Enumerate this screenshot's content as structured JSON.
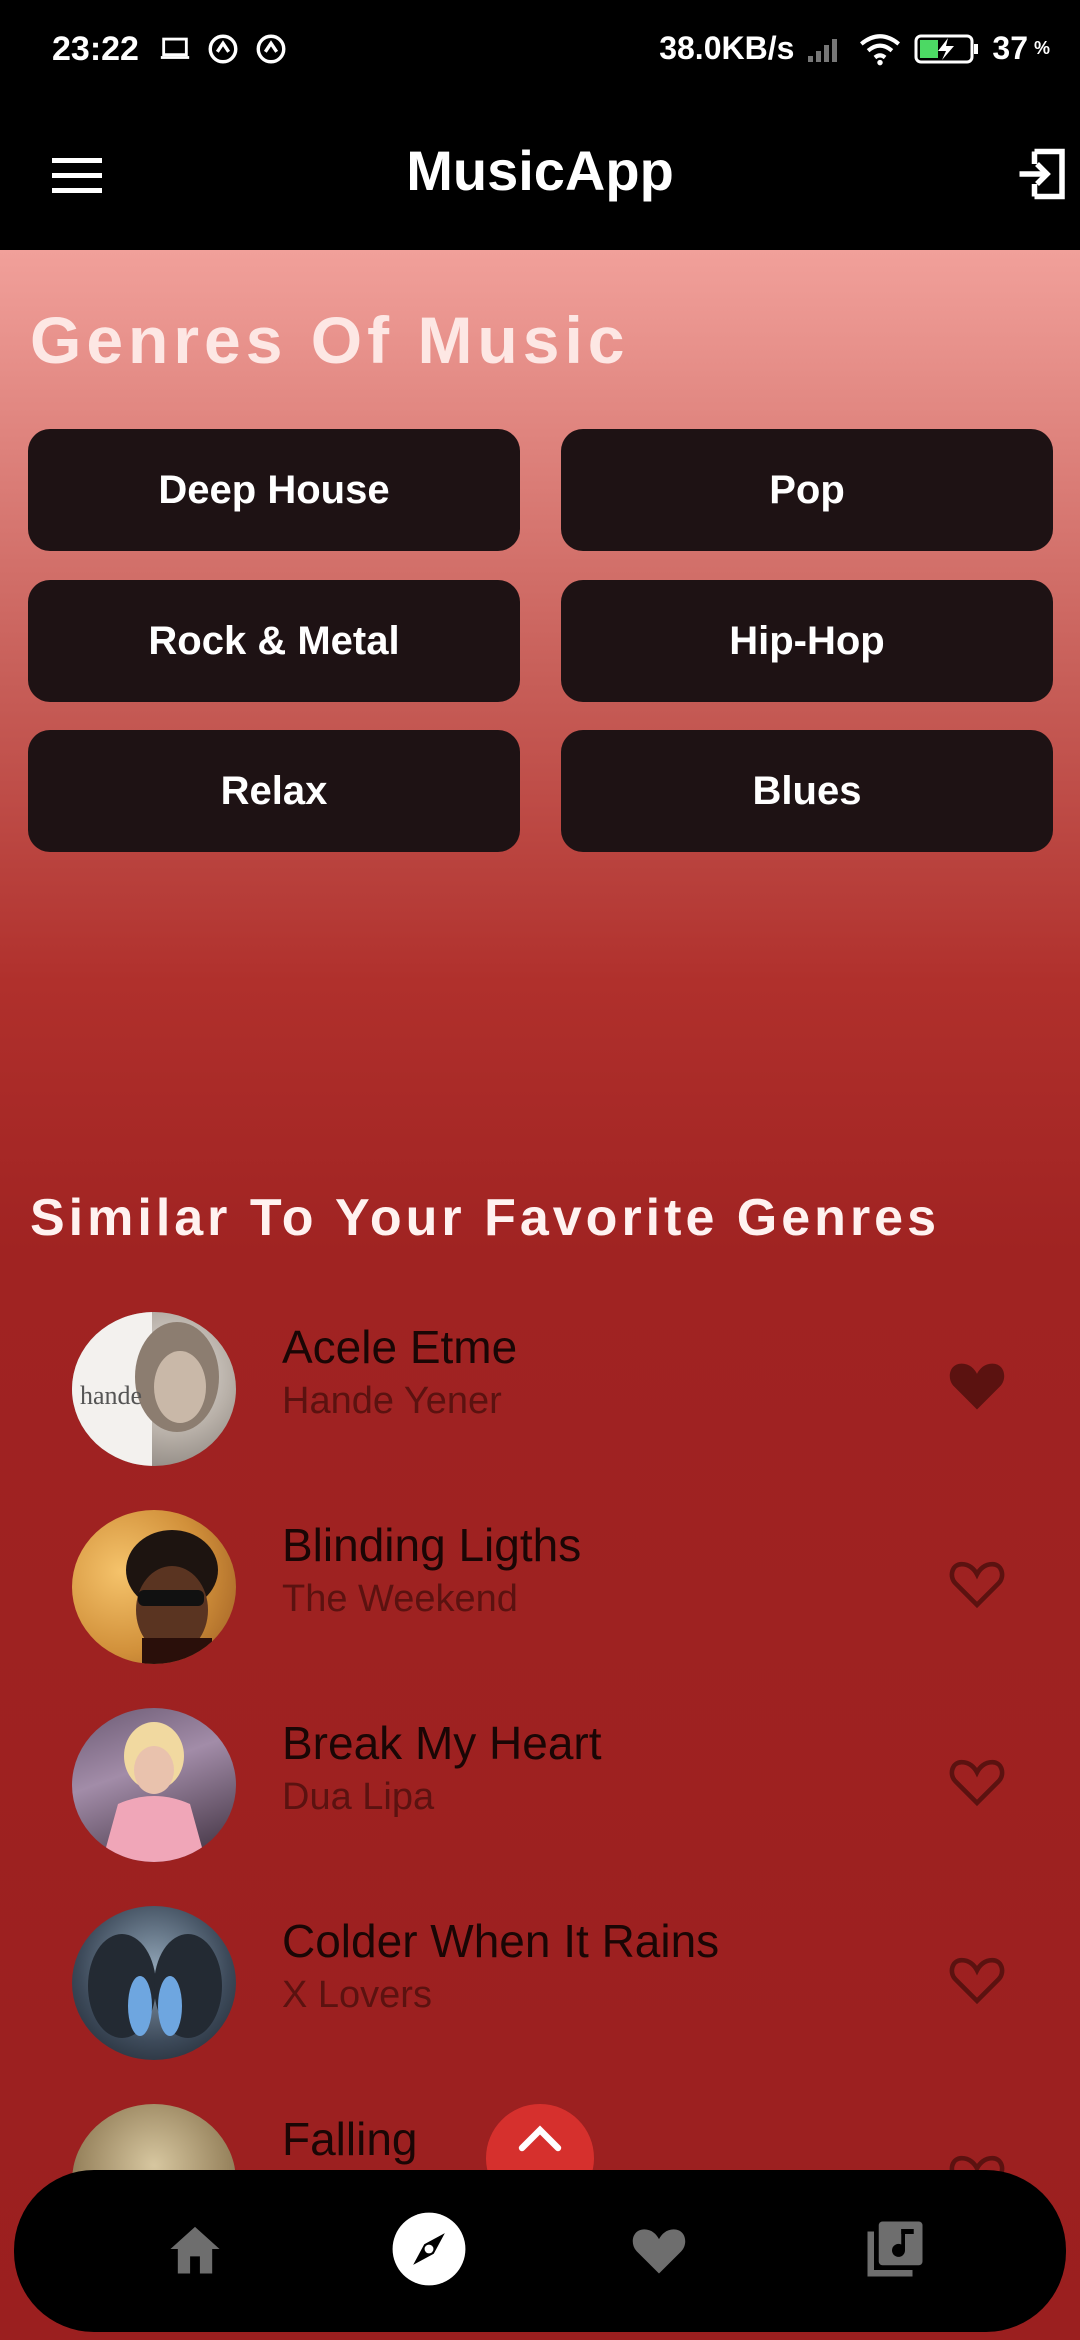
{
  "status_bar": {
    "time": "23:22",
    "network_speed": "38.0KB/s",
    "battery_level": "37",
    "battery_unit": "%"
  },
  "app_bar": {
    "title": "MusicApp",
    "menu_icon": "hamburger-menu-icon",
    "logout_icon": "logout-icon"
  },
  "genres_section": {
    "title": "Genres Of Music",
    "genres": [
      "Deep House",
      "Pop",
      "Rock & Metal",
      "Hip-Hop",
      "Relax",
      "Blues"
    ]
  },
  "similar_section": {
    "title": "Similar To Your Favorite Genres",
    "songs": [
      {
        "title": "Acele Etme",
        "artist": "Hande Yener",
        "favorited": true
      },
      {
        "title": "Blinding Ligths",
        "artist": "The Weekend",
        "favorited": false
      },
      {
        "title": "Break My Heart",
        "artist": "Dua Lipa",
        "favorited": false
      },
      {
        "title": "Colder When It Rains",
        "artist": "X Lovers",
        "favorited": false
      },
      {
        "title": "Falling",
        "artist": "",
        "favorited": false
      }
    ]
  },
  "bottom_nav": {
    "items": [
      "home-icon",
      "explore-icon",
      "favorites-icon",
      "library-icon"
    ],
    "active": "explore-icon"
  },
  "colors": {
    "accent": "#d6302d",
    "genre_button_bg": "#1e1214",
    "heart": "#5b1210"
  }
}
